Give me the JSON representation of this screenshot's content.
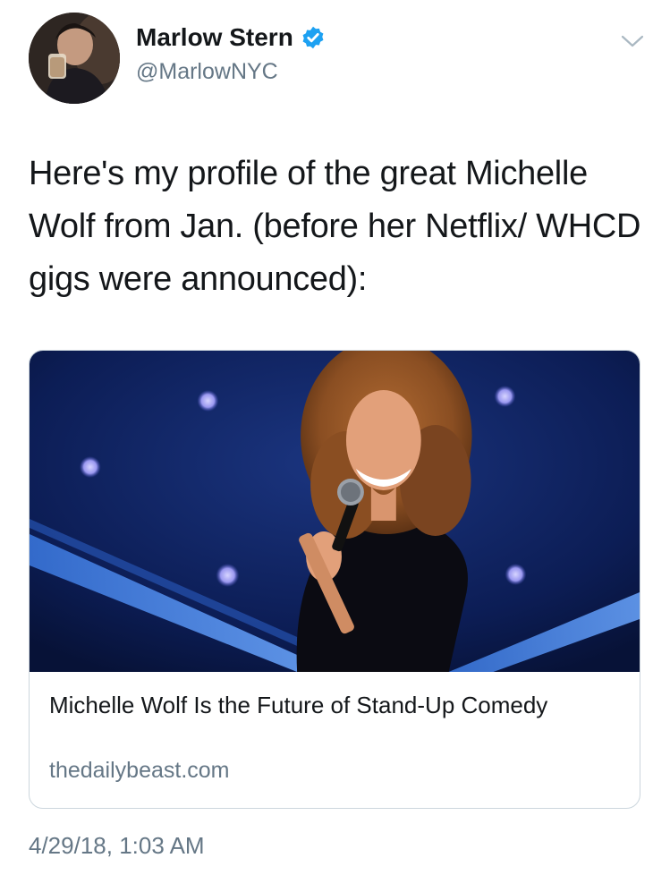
{
  "author": {
    "display_name": "Marlow Stern",
    "handle": "@MarlowNYC",
    "verified": true,
    "avatar": "profile-photo"
  },
  "tweet": {
    "text": "Here's my profile of the great Michelle Wolf from Jan. (before her Netflix/ WHCD gigs were announced):",
    "timestamp": "4/29/18, 1:03 AM"
  },
  "card": {
    "image": "comedian-on-stage-with-microphone",
    "title": "Michelle Wolf Is the Future of Stand-Up Comedy",
    "domain": "thedailybeast.com"
  },
  "icons": {
    "verified": "verified-badge-icon",
    "menu": "chevron-down-icon"
  },
  "colors": {
    "text_primary": "#14171a",
    "text_secondary": "#657786",
    "verified_blue": "#1da1f2",
    "card_border": "#ccd6dd",
    "stage_blue": "#0d1f5c"
  }
}
